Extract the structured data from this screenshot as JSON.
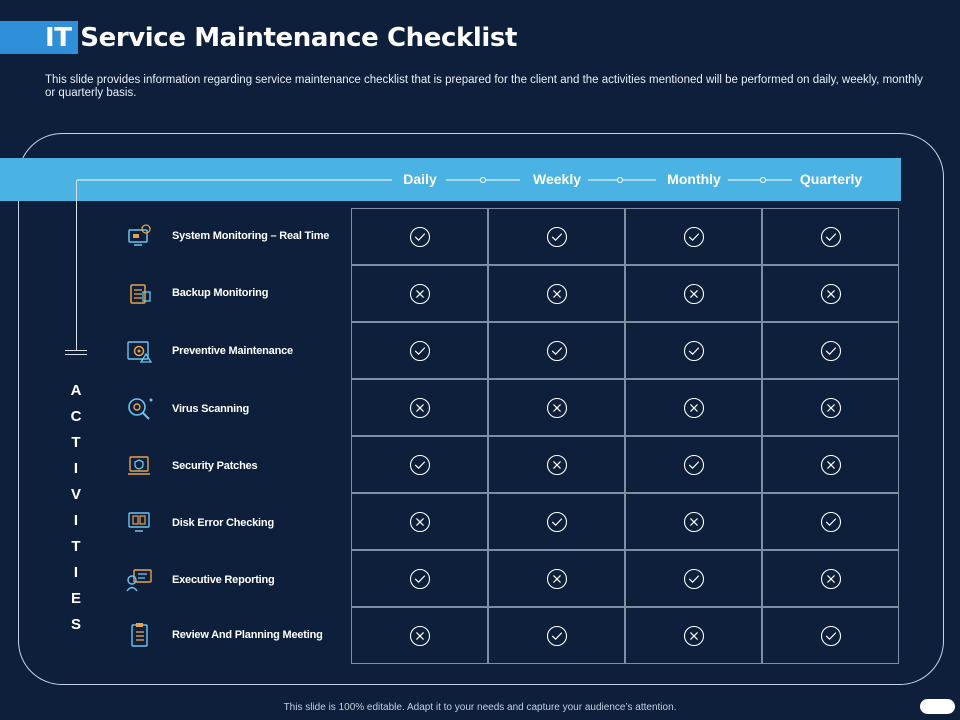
{
  "title": "IT Service Maintenance Checklist",
  "subtitle": "This slide provides information regarding service maintenance checklist that is prepared for the client and the activities mentioned will be performed on daily, weekly, monthly or quarterly basis.",
  "columns": [
    "Daily",
    "Weekly",
    "Monthly",
    "Quarterly"
  ],
  "side_label": [
    "A",
    "C",
    "T",
    "I",
    "V",
    "I",
    "T",
    "I",
    "E",
    "S"
  ],
  "rows": [
    {
      "label": "System Monitoring – Real Time",
      "icon": "monitor-network-icon",
      "marks": [
        "check",
        "check",
        "check",
        "check"
      ]
    },
    {
      "label": "Backup Monitoring",
      "icon": "backup-server-icon",
      "marks": [
        "cross",
        "cross",
        "cross",
        "cross"
      ]
    },
    {
      "label": "Preventive Maintenance",
      "icon": "gear-alert-icon",
      "marks": [
        "check",
        "check",
        "check",
        "check"
      ]
    },
    {
      "label": "Virus Scanning",
      "icon": "magnifier-virus-icon",
      "marks": [
        "cross",
        "cross",
        "cross",
        "cross"
      ]
    },
    {
      "label": "Security Patches",
      "icon": "shield-laptop-icon",
      "marks": [
        "check",
        "cross",
        "check",
        "cross"
      ]
    },
    {
      "label": "Disk Error Checking",
      "icon": "disk-monitor-icon",
      "marks": [
        "cross",
        "check",
        "cross",
        "check"
      ]
    },
    {
      "label": "Executive Reporting",
      "icon": "presentation-report-icon",
      "marks": [
        "check",
        "cross",
        "check",
        "cross"
      ]
    },
    {
      "label": "Review And Planning Meeting",
      "icon": "clipboard-checklist-icon",
      "marks": [
        "cross",
        "check",
        "cross",
        "check"
      ]
    }
  ],
  "colors": {
    "background": "#0d1f3a",
    "accent": "#4bb3e4",
    "icon_orange": "#e8a24a",
    "icon_blue": "#6cc4f0"
  },
  "footer": "This slide is 100% editable. Adapt it to your needs and capture your audience’s attention."
}
